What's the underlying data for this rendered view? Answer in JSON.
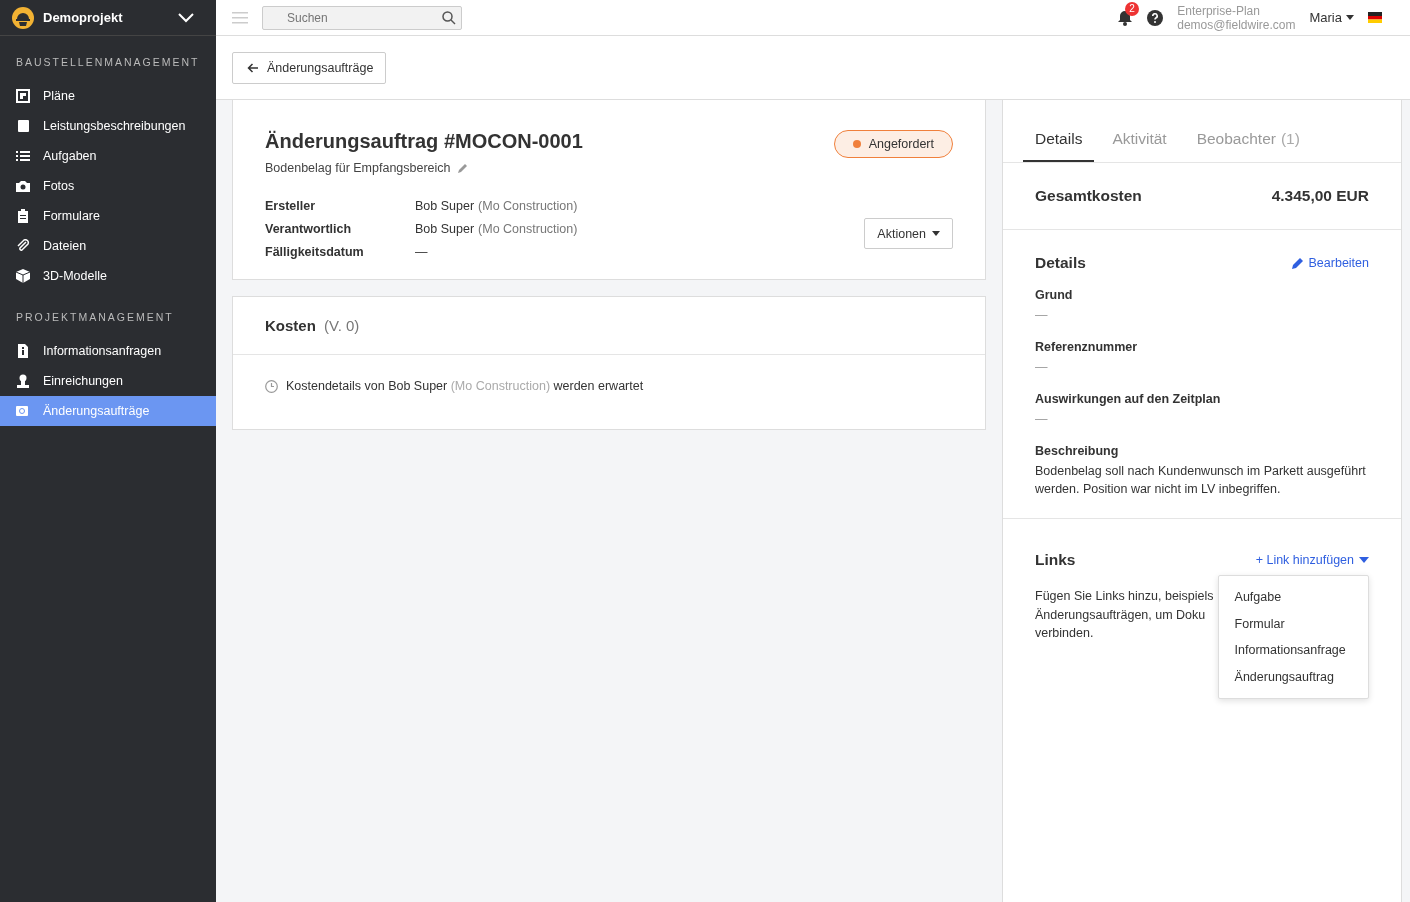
{
  "project": {
    "name": "Demoprojekt"
  },
  "sidebar": {
    "sections": [
      {
        "title": "BAUSTELLENMANAGEMENT",
        "items": [
          {
            "label": "Pläne",
            "selected": false
          },
          {
            "label": "Leistungsbeschreibungen",
            "selected": false
          },
          {
            "label": "Aufgaben",
            "selected": false
          },
          {
            "label": "Fotos",
            "selected": false
          },
          {
            "label": "Formulare",
            "selected": false
          },
          {
            "label": "Dateien",
            "selected": false
          },
          {
            "label": "3D-Modelle",
            "selected": false
          }
        ]
      },
      {
        "title": "PROJEKTMANAGEMENT",
        "items": [
          {
            "label": "Informationsanfragen",
            "selected": false
          },
          {
            "label": "Einreichungen",
            "selected": false
          },
          {
            "label": "Änderungsaufträge",
            "selected": true
          }
        ]
      }
    ]
  },
  "topbar": {
    "search": {
      "placeholder": "Suchen"
    },
    "notifications": "2",
    "plan": "Enterprise-Plan",
    "email": "demos@fieldwire.com",
    "user": "Maria"
  },
  "back_button": "Änderungsaufträge",
  "order": {
    "title": "Änderungsauftrag #MOCON-0001",
    "subtitle": "Bodenbelag für Empfangsbereich",
    "status": {
      "label": "Angefordert",
      "color": "#f0803c"
    },
    "fields": [
      {
        "label": "Ersteller",
        "value": "Bob Super",
        "company": "(Mo Construction)"
      },
      {
        "label": "Verantwortlich",
        "value": "Bob Super",
        "company": "(Mo Construction)"
      },
      {
        "label": "Fälligkeitsdatum",
        "value": "—"
      }
    ],
    "actions": "Aktionen"
  },
  "costs": {
    "title": "Kosten",
    "version": "(V. 0)",
    "message": {
      "before": "Kostendetails von Bob Super",
      "company": "(Mo Construction)",
      "after": "werden erwartet"
    }
  },
  "panel": {
    "tabs": [
      {
        "label": "Details",
        "selected": true
      },
      {
        "label": "Aktivität",
        "selected": false
      },
      {
        "label": "Beobachter",
        "count": "(1)",
        "selected": false
      }
    ],
    "total": {
      "label": "Gesamtkosten",
      "value": "4.345,00 EUR"
    },
    "details": {
      "title": "Details",
      "edit": "Bearbeiten",
      "fields": [
        {
          "label": "Grund",
          "value": "—"
        },
        {
          "label": "Referenznummer",
          "value": "—"
        },
        {
          "label": "Auswirkungen auf den Zeitplan",
          "value": "—"
        },
        {
          "label": "Beschreibung",
          "value": "Bodenbelag soll nach Kundenwunsch  im Parkett ausgeführt werden. Position war nicht im LV inbegriffen."
        }
      ]
    },
    "links": {
      "title": "Links",
      "add": "+ Link hinzufügen",
      "hint_lines": [
        "Fügen Sie Links hinzu, beispiels",
        "Änderungsaufträgen, um Doku",
        "verbinden."
      ],
      "menu": [
        "Aufgabe",
        "Formular",
        "Informationsanfrage",
        "Änderungsauftrag"
      ]
    }
  }
}
